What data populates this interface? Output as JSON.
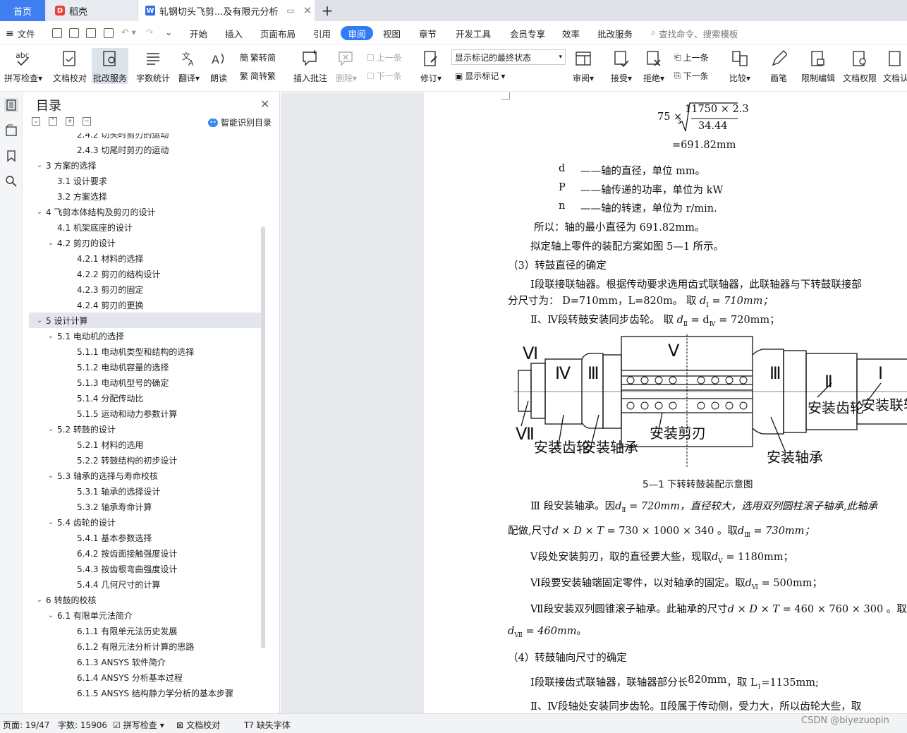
{
  "tabs": {
    "home": "首页",
    "daoke": "稻壳",
    "doc": "轧钢切头飞剪...及有限元分析",
    "new_tab": "+"
  },
  "menu": {
    "file": "文件",
    "items": [
      "开始",
      "插入",
      "页面布局",
      "引用",
      "审阅",
      "视图",
      "章节",
      "开发工具",
      "会员专享",
      "效率",
      "批改服务"
    ],
    "active": "审阅",
    "search": "查找命令、搜索模板"
  },
  "toolbar": {
    "spellcheck": "拼写检查",
    "proofread": "文档校对",
    "revise_service": "批改服务",
    "word_count": "字数统计",
    "translate": "翻译",
    "read_aloud": "朗读",
    "to_traditional": "繁转简",
    "to_simplified": "简转繁",
    "insert_comment": "插入批注",
    "delete": "删除",
    "prev": "上一条",
    "next": "下一条",
    "track": "修订",
    "show_state": "显示标记的最终状态",
    "show_markup": "显示标记",
    "review": "审阅",
    "accept": "接受",
    "reject": "拒绝",
    "prev2": "上一条",
    "next2": "下一条",
    "compare": "比较",
    "pen": "画笔",
    "restrict_edit": "限制编辑",
    "doc_permission": "文档权限",
    "doc_auth": "文档认"
  },
  "toc": {
    "title": "目录",
    "smart": "智能识别目录",
    "items": [
      {
        "text": "2.4.2  切头时剪刃的运动",
        "level": 3,
        "arrow": ""
      },
      {
        "text": "2.4.3  切尾时剪刃的运动",
        "level": 3,
        "arrow": ""
      },
      {
        "text": "3  方案的选择",
        "level": 1,
        "arrow": "v"
      },
      {
        "text": "3.1  设计要求",
        "level": 2,
        "arrow": ""
      },
      {
        "text": "3.2  方案选择",
        "level": 2,
        "arrow": ""
      },
      {
        "text": "4 飞剪本体结构及剪刃的设计",
        "level": 1,
        "arrow": "v"
      },
      {
        "text": "4.1 机架底座的设计",
        "level": 2,
        "arrow": ""
      },
      {
        "text": "4.2 剪刃的设计",
        "level": 2,
        "arrow": "v"
      },
      {
        "text": "4.2.1 材料的选择",
        "level": 3,
        "arrow": ""
      },
      {
        "text": "4.2.2 剪刃的结构设计",
        "level": 3,
        "arrow": ""
      },
      {
        "text": "4.2.3 剪刃的固定",
        "level": 3,
        "arrow": ""
      },
      {
        "text": "4.2.4  剪刃的更换",
        "level": 3,
        "arrow": ""
      },
      {
        "text": "5  设计计算",
        "level": 1,
        "arrow": "v",
        "selected": true
      },
      {
        "text": "5.1 电动机的选择",
        "level": 2,
        "arrow": "v"
      },
      {
        "text": "5.1.1 电动机类型和结构的选择",
        "level": 3,
        "arrow": ""
      },
      {
        "text": "5.1.2  电动机容量的选择",
        "level": 3,
        "arrow": ""
      },
      {
        "text": "5.1.3  电动机型号的确定",
        "level": 3,
        "arrow": ""
      },
      {
        "text": "5.1.4  分配传动比",
        "level": 3,
        "arrow": ""
      },
      {
        "text": "5.1.5  运动和动力参数计算",
        "level": 3,
        "arrow": ""
      },
      {
        "text": "5.2  转鼓的设计",
        "level": 2,
        "arrow": "v"
      },
      {
        "text": "5.2.1  材料的选用",
        "level": 3,
        "arrow": ""
      },
      {
        "text": "5.2.2  转鼓结构的初步设计",
        "level": 3,
        "arrow": ""
      },
      {
        "text": "5.3 轴承的选择与寿命校核",
        "level": 2,
        "arrow": "v"
      },
      {
        "text": "5.3.1  轴承的选择设计",
        "level": 3,
        "arrow": ""
      },
      {
        "text": "5.3.2  轴承寿命计算",
        "level": 3,
        "arrow": ""
      },
      {
        "text": "5.4  齿轮的设计",
        "level": 2,
        "arrow": "v"
      },
      {
        "text": "5.4.1  基本参数选择",
        "level": 3,
        "arrow": ""
      },
      {
        "text": "6.4.2  按齿面接触强度设计",
        "level": 3,
        "arrow": ""
      },
      {
        "text": "5.4.3 按齿根弯曲强度设计",
        "level": 3,
        "arrow": ""
      },
      {
        "text": "5.4.4  几何尺寸的计算",
        "level": 3,
        "arrow": ""
      },
      {
        "text": "6  转鼓的校核",
        "level": 1,
        "arrow": "v"
      },
      {
        "text": "6.1 有限单元法简介",
        "level": 2,
        "arrow": "v"
      },
      {
        "text": "6.1.1  有限单元法历史发展",
        "level": 3,
        "arrow": ""
      },
      {
        "text": "6.1.2 有限元法分析计算的思路",
        "level": 3,
        "arrow": ""
      },
      {
        "text": "6.1.3    ANSYS 软件简介",
        "level": 3,
        "arrow": ""
      },
      {
        "text": "6.1.4    ANSYS 分析基本过程",
        "level": 3,
        "arrow": ""
      },
      {
        "text": "6.1.5 ANSYS 结构静力学分析的基本步骤",
        "level": 3,
        "arrow": ""
      }
    ]
  },
  "doc": {
    "formula_coef": "75 ×",
    "formula_root": "3",
    "formula_num": "11750 × 2.3",
    "formula_den": "34.44",
    "formula_result": "=691.82mm",
    "def_d_sym": "d",
    "def_d": "——轴的直径，单位 mm。",
    "def_p_sym": "P",
    "def_p": "——轴传递的功率，单位为 kW",
    "def_n_sym": "n",
    "def_n": "——轴的转速，单位为 r/min.",
    "line_min_dia": "所以：轴的最小直径为 691.82mm。",
    "line_plan": "拟定轴上零件的装配方案如图 5—1 所示。",
    "h3": "（3）转鼓直径的确定",
    "p1a": "Ⅰ段联接联轴器。根据传动要求选用齿式联轴器，此联轴器与下转鼓联接部",
    "p1b": "分尺寸为：  D=710mm，L=820m。    取",
    "p1b_f": "d",
    "p1b_sub": "Ⅰ",
    "p1b_v": " = 710mm；",
    "p2": "Ⅱ、Ⅳ段转鼓安装同步齿轮。  取",
    "p2_f": "d",
    "p2_sub1": "Ⅱ",
    "p2_mid": " = d",
    "p2_sub2": "Ⅳ",
    "p2_v": " = 720mm；",
    "fig_labels": [
      "Ⅵ",
      "Ⅳ",
      "Ⅲ",
      "Ⅴ",
      "Ⅲ",
      "Ⅱ",
      "Ⅰ",
      "Ⅶ",
      "安装齿轮",
      "安装轴承",
      "安装剪刃",
      "安装轴承",
      "安装齿轮",
      "安装联轴器"
    ],
    "caption": "5—1 下转转鼓装配示意图",
    "p3a": "Ⅲ 段安装轴承。因",
    "p3a_f": "d",
    "p3a_sub": "Ⅱ",
    "p3a_v": " = 720mm，直径较大，选用双列圆柱滚子轴承,此轴承",
    "p3b": "配做,尺寸",
    "p3b_f": "d × D × T",
    "p3b_v": " = 730 × 1000 × 340 。取",
    "p3b_f2": "d",
    "p3b_sub2": "Ⅲ",
    "p3b_v2": " = 730mm；",
    "p4": "Ⅴ段处安装剪刃，取的直径要大些，现取",
    "p4_f": "d",
    "p4_sub": "Ⅴ",
    "p4_v": " = 1180mm；",
    "p5": "Ⅵ段要安装轴端固定零件，以对轴承的固定。取",
    "p5_f": "d",
    "p5_sub": "Ⅵ",
    "p5_v": " = 500mm；",
    "p6a": "Ⅶ段安装双列圆锥滚子轴承。此轴承的尺寸",
    "p6a_f": "d × D × T",
    "p6a_v": " = 460 × 760 × 300 。取",
    "p6b_f": "d",
    "p6b_sub": "Ⅶ",
    "p6b_v": " = 460mm",
    "p6b_end": "。",
    "h4": "（4）转鼓轴向尺寸的确定",
    "p7": "Ⅰ段联接齿式联轴器，联轴器部分长",
    "p7_v": "820mm",
    "p7_b": "，取 L",
    "p7_sub": "1",
    "p7_c": "=1135mm;",
    "p8": "Ⅱ、Ⅳ段轴处安装同步齿轮。Ⅱ段属于传动侧，受力大，所以齿轮大些，取"
  },
  "status": {
    "page": "页面: 19/47",
    "words": "字数: 15906",
    "spell": "拼写检查",
    "proof": "文档校对",
    "missing_font": "缺失字体"
  },
  "watermark": "CSDN @biyezuopin",
  "colors": {
    "accent": "#2f7cf6",
    "home_tab": "#3f7ef0"
  }
}
